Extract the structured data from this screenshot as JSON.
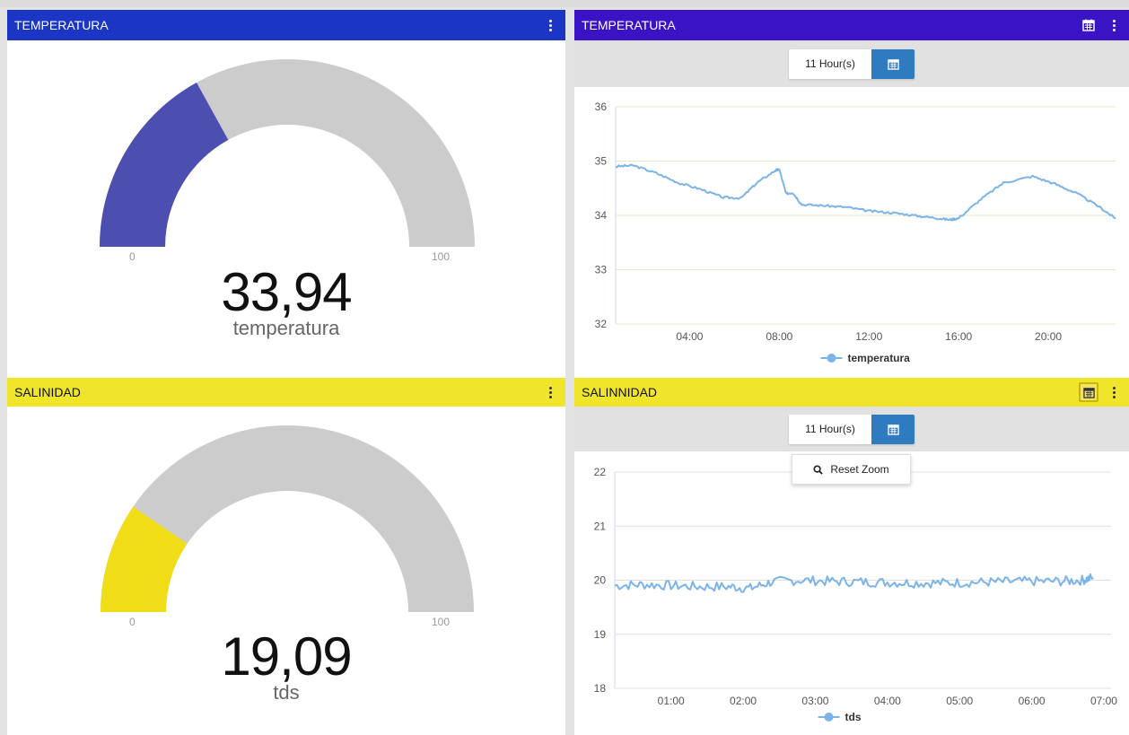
{
  "colors": {
    "temp_header_left": "#1b35c4",
    "temp_header_right": "#3a14c4",
    "temp_gauge": "#4c4fb0",
    "sal_header": "#f0e52a",
    "sal_gauge": "#f0dd18",
    "gauge_track": "#cccccc",
    "line": "#7cb4e8"
  },
  "widgets": {
    "temp_gauge": {
      "title": "TEMPERATURA",
      "value_text": "33,94",
      "value": 33.94,
      "label": "temperatura",
      "min": "0",
      "max": "100",
      "menu_icon": "kebab-menu-icon"
    },
    "temp_chart": {
      "title": "TEMPERATURA",
      "period": "11 Hour(s)",
      "calendar_icon": "calendar-icon",
      "menu_icon": "kebab-menu-icon"
    },
    "sal_gauge": {
      "title": "SALINIDAD",
      "value_text": "19,09",
      "value": 19.09,
      "label": "tds",
      "min": "0",
      "max": "100",
      "menu_icon": "kebab-menu-icon"
    },
    "sal_chart": {
      "title": "SALINNIDAD",
      "period": "11 Hour(s)",
      "reset_zoom": "Reset Zoom",
      "calendar_icon": "calendar-icon",
      "menu_icon": "kebab-menu-icon"
    }
  },
  "chart_data": [
    {
      "type": "line",
      "ylim": [
        32,
        36
      ],
      "yticks": [
        "32",
        "33",
        "34",
        "35",
        "36"
      ],
      "xlim": [
        0.7,
        23.0
      ],
      "xticks": [
        "04:00",
        "08:00",
        "12:00",
        "16:00",
        "20:00"
      ],
      "xtick_values": [
        4,
        8,
        12,
        16,
        20
      ],
      "series": [
        {
          "name": "temperatura",
          "points": [
            [
              0.7,
              34.9
            ],
            [
              1.5,
              34.92
            ],
            [
              2.5,
              34.78
            ],
            [
              3.5,
              34.6
            ],
            [
              4.5,
              34.48
            ],
            [
              5.5,
              34.33
            ],
            [
              6.3,
              34.32
            ],
            [
              7.0,
              34.6
            ],
            [
              7.8,
              34.82
            ],
            [
              8.0,
              34.85
            ],
            [
              8.3,
              34.4
            ],
            [
              8.6,
              34.42
            ],
            [
              9.0,
              34.2
            ],
            [
              10.0,
              34.18
            ],
            [
              11.0,
              34.15
            ],
            [
              12.0,
              34.08
            ],
            [
              13.0,
              34.05
            ],
            [
              14.0,
              34.0
            ],
            [
              15.0,
              33.95
            ],
            [
              15.6,
              33.92
            ],
            [
              16.0,
              33.95
            ],
            [
              17.0,
              34.3
            ],
            [
              18.0,
              34.6
            ],
            [
              19.3,
              34.72
            ],
            [
              20.3,
              34.58
            ],
            [
              21.3,
              34.4
            ],
            [
              22.3,
              34.15
            ],
            [
              23.0,
              33.94
            ]
          ]
        }
      ]
    },
    {
      "type": "line",
      "ylim": [
        18,
        22
      ],
      "yticks": [
        "18",
        "19",
        "20",
        "21",
        "22"
      ],
      "xlim": [
        0.22,
        7.1
      ],
      "xticks": [
        "01:00",
        "02:00",
        "03:00",
        "04:00",
        "05:00",
        "06:00",
        "07:00"
      ],
      "xtick_values": [
        1,
        2,
        3,
        4,
        5,
        6,
        7
      ],
      "series": [
        {
          "name": "tds",
          "points": [
            [
              0.22,
              19.9
            ],
            [
              0.6,
              19.92
            ],
            [
              1.0,
              19.9
            ],
            [
              1.4,
              19.88
            ],
            [
              1.8,
              19.88
            ],
            [
              2.1,
              19.85
            ],
            [
              2.4,
              19.97
            ],
            [
              2.8,
              20.0
            ],
            [
              3.2,
              19.98
            ],
            [
              3.6,
              19.97
            ],
            [
              4.0,
              19.96
            ],
            [
              4.4,
              19.95
            ],
            [
              4.8,
              19.95
            ],
            [
              5.2,
              19.96
            ],
            [
              5.6,
              19.97
            ],
            [
              6.0,
              19.98
            ],
            [
              6.4,
              19.98
            ],
            [
              6.7,
              20.0
            ],
            [
              6.85,
              20.05
            ]
          ]
        }
      ]
    }
  ]
}
